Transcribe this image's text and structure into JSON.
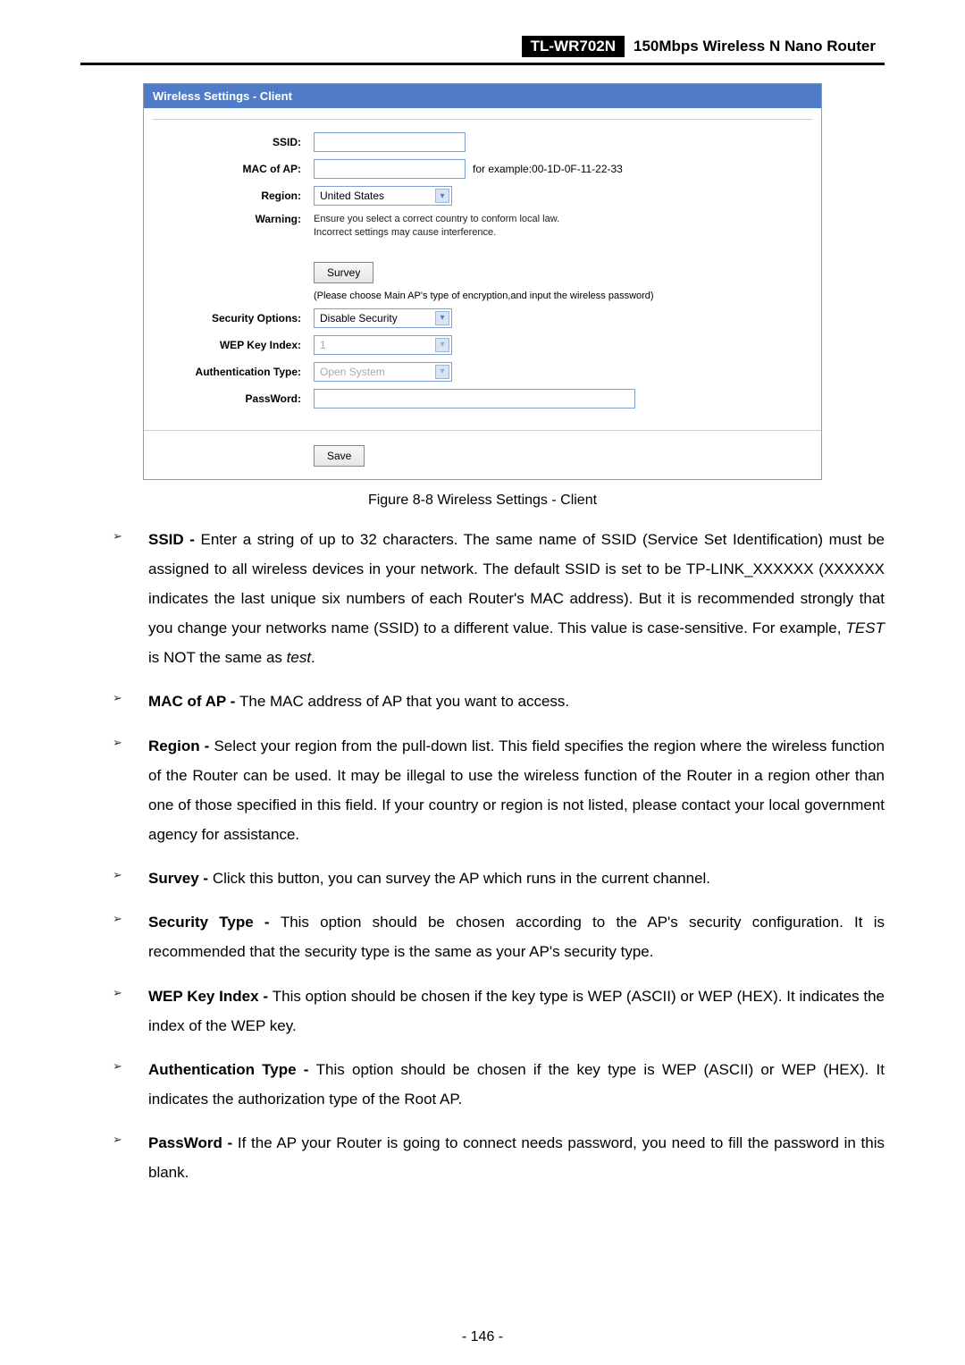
{
  "header": {
    "model": "TL-WR702N",
    "product": "150Mbps  Wireless  N  Nano  Router"
  },
  "panel": {
    "title": "Wireless Settings - Client",
    "rows": {
      "ssid_label": "SSID:",
      "mac_label": "MAC of AP:",
      "mac_example": "for example:00-1D-0F-11-22-33",
      "region_label": "Region:",
      "region_value": "United States",
      "warning_label": "Warning:",
      "warning_text1": "Ensure you select a correct country to conform local law.",
      "warning_text2": "Incorrect settings may cause interference.",
      "survey_btn": "Survey",
      "survey_hint": "(Please choose Main AP's type of encryption,and input the wireless password)",
      "security_label": "Security Options:",
      "security_value": "Disable Security",
      "wep_label": "WEP Key Index:",
      "wep_value": "1",
      "auth_label": "Authentication Type:",
      "auth_value": "Open System",
      "pwd_label": "PassWord:",
      "save_btn": "Save"
    }
  },
  "figure_caption": "Figure 8-8 Wireless Settings - Client",
  "list": {
    "ssid": {
      "title": "SSID - ",
      "text1": "Enter a string of up to 32 characters. The same name of SSID (Service Set Identification) must be assigned to all wireless devices in your network. The default SSID is set to be TP-LINK_XXXXXX (XXXXXX indicates the last unique six numbers of each Router's MAC address). But it is recommended strongly that you change your networks name (SSID) to a different value. This value is case-sensitive. For example, ",
      "test_upper": "TEST",
      "text2": " is NOT the same as ",
      "test_lower": "test",
      "text3": "."
    },
    "mac": {
      "title": "MAC of AP - ",
      "text": "The MAC address of AP that you want to access."
    },
    "region": {
      "title": "Region - ",
      "text": "Select your region from the pull-down list. This field specifies the region where the wireless function of the Router can be used. It may be illegal to use the wireless function of the Router in a region other than one of those specified in this field. If your country or region is not listed, please contact your local government agency for assistance."
    },
    "survey": {
      "title": "Survey - ",
      "text": "Click this button, you can survey the AP which runs in the current channel."
    },
    "sectype": {
      "title": "Security Type - ",
      "text": "This option should be chosen according to the AP's security configuration. It is recommended that the security type is the same as your AP's security type."
    },
    "wep": {
      "title": "WEP Key Index - ",
      "text": "This option should be chosen if the key type is WEP (ASCII) or WEP (HEX). It indicates the index of the WEP key."
    },
    "auth": {
      "title": "Authentication Type - ",
      "text": "This option should be chosen if the key type is WEP (ASCII) or WEP (HEX). It indicates the authorization type of the Root AP."
    },
    "pwd": {
      "title": "PassWord - ",
      "text": "If the AP your Router is going to connect needs password, you need to fill the password in this blank."
    }
  },
  "page_number": "- 146 -"
}
